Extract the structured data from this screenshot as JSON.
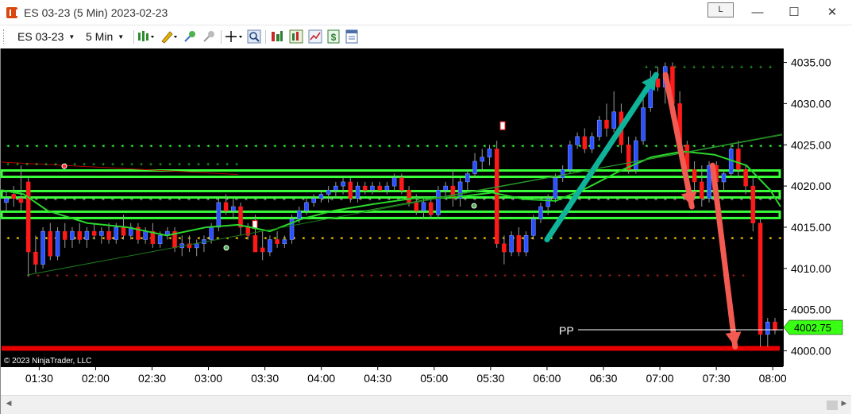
{
  "window": {
    "title": "ES 03-23 (5 Min)  2023-02-23",
    "link_button": "L",
    "minimize_glyph": "—",
    "maximize_glyph": "☐",
    "close_glyph": "✕"
  },
  "toolbar": {
    "instrument": "ES 03-23",
    "interval": "5 Min"
  },
  "chart": {
    "copyright": "© 2023 NinjaTrader, LLC",
    "pp_label": "PP",
    "last_price_badge": "4002.75",
    "colors": {
      "up": "#2a50ff",
      "down": "#ff1a1a",
      "wick": "#9a9a9a",
      "band": "#39ff39",
      "ma": "#2bd82b",
      "arrow_up": "#0fb39a",
      "arrow_down": "#f25a52",
      "support": "#e80000"
    }
  },
  "chart_data": {
    "type": "candlestick",
    "instrument": "ES 03-23",
    "interval": "5 Min",
    "date": "2023-02-23",
    "x_ticks": [
      "01:30",
      "02:00",
      "02:30",
      "03:00",
      "03:30",
      "04:00",
      "04:30",
      "05:00",
      "05:30",
      "06:00",
      "06:30",
      "07:00",
      "07:30",
      "08:00"
    ],
    "y_ticks": [
      "4000.00",
      "4005.00",
      "4010.00",
      "4015.00",
      "4020.00",
      "4025.00",
      "4030.00",
      "4035.00"
    ],
    "ylim": [
      3999.5,
      4036.5
    ],
    "xlim": [
      "01:10",
      "08:05"
    ],
    "levels": {
      "green_bands": [
        4021.5,
        4019.0,
        4016.5
      ],
      "red_support": 4000.3,
      "pp": 4002.5,
      "dots_green_top": 4025.0,
      "dots_green_high": 4034.5,
      "dots_yellow": 4013.8,
      "dots_red_low": 4009.2,
      "dots_white_mid": 4018.5
    },
    "last_price": 4002.75,
    "arrows": [
      {
        "color": "teal",
        "from": [
          "06:00",
          4013.5
        ],
        "to": [
          "06:58",
          4033.5
        ]
      },
      {
        "color": "salmon",
        "from": [
          "07:03",
          4033.5
        ],
        "to": [
          "07:17",
          4017.5
        ]
      },
      {
        "color": "salmon",
        "from": [
          "07:28",
          4022.5
        ],
        "to": [
          "07:40",
          4000.5
        ]
      }
    ],
    "candles": [
      [
        4018,
        4019.5,
        4017,
        4018.5
      ],
      [
        4019,
        4020,
        4017.5,
        4018.5
      ],
      [
        4018.5,
        4022.5,
        4017,
        4018
      ],
      [
        4020.5,
        4021,
        4009,
        4012
      ],
      [
        4012,
        4014,
        4009.5,
        4010.5
      ],
      [
        4010.5,
        4015,
        4010,
        4014.5
      ],
      [
        4014.5,
        4015.5,
        4011,
        4011.5
      ],
      [
        4011.5,
        4015,
        4011,
        4014.5
      ],
      [
        4014.5,
        4015.5,
        4012.5,
        4013.5
      ],
      [
        4013.5,
        4015,
        4012.5,
        4014.5
      ],
      [
        4014.5,
        4015.5,
        4013,
        4013.5
      ],
      [
        4013.5,
        4015,
        4012.5,
        4014.5
      ],
      [
        4014.5,
        4015.5,
        4013.5,
        4014
      ],
      [
        4014,
        4015,
        4013,
        4014.5
      ],
      [
        4014.5,
        4015.5,
        4013,
        4013.5
      ],
      [
        4013.5,
        4015.5,
        4013,
        4015
      ],
      [
        4015,
        4016.5,
        4013.5,
        4014
      ],
      [
        4014,
        4015.5,
        4013.5,
        4015
      ],
      [
        4015,
        4015.5,
        4013,
        4013.5
      ],
      [
        4013.5,
        4015,
        4013,
        4014.5
      ],
      [
        4014.5,
        4015.5,
        4012.5,
        4013
      ],
      [
        4013,
        4014.5,
        4012.5,
        4014
      ],
      [
        4014,
        4015,
        4013.5,
        4014.5
      ],
      [
        4014.5,
        4015,
        4012,
        4012.5
      ],
      [
        4012.5,
        4014,
        4011.5,
        4013
      ],
      [
        4013,
        4014,
        4012,
        4012.5
      ],
      [
        4012.5,
        4013.5,
        4011.5,
        4013
      ],
      [
        4013,
        4014,
        4012,
        4013.5
      ],
      [
        4013.5,
        4015.5,
        4013,
        4015
      ],
      [
        4015,
        4018.5,
        4014.5,
        4018
      ],
      [
        4018,
        4019,
        4016.5,
        4017
      ],
      [
        4017,
        4018.5,
        4016,
        4017.5
      ],
      [
        4017.5,
        4018,
        4014,
        4015
      ],
      [
        4015,
        4015.5,
        4013.5,
        4014
      ],
      [
        4014,
        4016.5,
        4013,
        4012
      ],
      [
        4012.5,
        4014.5,
        4011,
        4012
      ],
      [
        4012,
        4014,
        4011.5,
        4013.5
      ],
      [
        4013.5,
        4014.5,
        4012.5,
        4013
      ],
      [
        4013,
        4014,
        4012.5,
        4013.5
      ],
      [
        4013.5,
        4016.5,
        4013,
        4016
      ],
      [
        4016,
        4017.5,
        4015.5,
        4017
      ],
      [
        4017,
        4018.5,
        4016.5,
        4018
      ],
      [
        4018,
        4019,
        4017.5,
        4018.5
      ],
      [
        4018.5,
        4019.5,
        4018,
        4019
      ],
      [
        4019,
        4020,
        4018,
        4019.5
      ],
      [
        4019.5,
        4020.5,
        4018.5,
        4020
      ],
      [
        4020,
        4021,
        4019,
        4020.5
      ],
      [
        4020.5,
        4021,
        4018,
        4018.5
      ],
      [
        4018.5,
        4020.5,
        4018,
        4020
      ],
      [
        4020,
        4020.5,
        4019,
        4019.5
      ],
      [
        4019.5,
        4020.5,
        4019,
        4020
      ],
      [
        4020,
        4020.5,
        4019.5,
        4019.5
      ],
      [
        4019.5,
        4020.5,
        4019,
        4020
      ],
      [
        4020,
        4021.5,
        4019.5,
        4021
      ],
      [
        4021,
        4021.5,
        4019,
        4019.5
      ],
      [
        4019.5,
        4020,
        4017.5,
        4018
      ],
      [
        4018,
        4019,
        4016.5,
        4017
      ],
      [
        4017,
        4018.5,
        4016,
        4018
      ],
      [
        4018,
        4018.5,
        4016,
        4016.5
      ],
      [
        4016.5,
        4020,
        4016,
        4019.5
      ],
      [
        4019.5,
        4020.5,
        4018.5,
        4020
      ],
      [
        4020,
        4022,
        4017.5,
        4018.5
      ],
      [
        4018.5,
        4021,
        4017.5,
        4020.5
      ],
      [
        4020.5,
        4022,
        4019.5,
        4021.5
      ],
      [
        4021.5,
        4024,
        4021,
        4023
      ],
      [
        4023,
        4024.5,
        4022,
        4023.5
      ],
      [
        4023.5,
        4025,
        4022.5,
        4024.5
      ],
      [
        4024.5,
        4025.5,
        4012.5,
        4013
      ],
      [
        4013,
        4014,
        4010.5,
        4012
      ],
      [
        4012,
        4014.5,
        4011.5,
        4014
      ],
      [
        4014,
        4015,
        4011.5,
        4012
      ],
      [
        4012,
        4014.5,
        4011.5,
        4014
      ],
      [
        4014,
        4016.5,
        4013.5,
        4016
      ],
      [
        4016,
        4018,
        4015.5,
        4017.5
      ],
      [
        4017.5,
        4019,
        4016.5,
        4018.5
      ],
      [
        4018.5,
        4021.5,
        4018,
        4021
      ],
      [
        4021,
        4022.5,
        4020.5,
        4022
      ],
      [
        4022,
        4025.5,
        4021.5,
        4025
      ],
      [
        4025,
        4026.5,
        4024.5,
        4026
      ],
      [
        4026,
        4027,
        4024,
        4024.5
      ],
      [
        4024.5,
        4026.5,
        4024,
        4026
      ],
      [
        4026,
        4028.5,
        4025.5,
        4028
      ],
      [
        4028,
        4030,
        4026,
        4027
      ],
      [
        4027,
        4031.5,
        4026.5,
        4029
      ],
      [
        4029,
        4030,
        4024,
        4025
      ],
      [
        4025,
        4026,
        4021.5,
        4022
      ],
      [
        4022,
        4026,
        4021.5,
        4025.5
      ],
      [
        4025.5,
        4030.5,
        4025,
        4029.5
      ],
      [
        4029.5,
        4034,
        4029,
        4033
      ],
      [
        4033,
        4034.5,
        4031.5,
        4032
      ],
      [
        4032,
        4035,
        4030,
        4034.5
      ],
      [
        4034.5,
        4035,
        4029,
        4030
      ],
      [
        4030,
        4031.5,
        4024,
        4025
      ],
      [
        4025,
        4025.5,
        4021.5,
        4022
      ],
      [
        4022,
        4023,
        4019.5,
        4020.5
      ],
      [
        4020.5,
        4022.5,
        4017.5,
        4018.5
      ],
      [
        4018.5,
        4023,
        4018,
        4022.5
      ],
      [
        4022.5,
        4023,
        4020,
        4020.5
      ],
      [
        4020.5,
        4022,
        4019.5,
        4021.5
      ],
      [
        4021.5,
        4025,
        4021,
        4024.5
      ],
      [
        4024.5,
        4025.5,
        4021,
        4022
      ],
      [
        4022,
        4022.5,
        4019,
        4020
      ],
      [
        4020,
        4021,
        4014.5,
        4015.5
      ],
      [
        4015.5,
        4016,
        4000.5,
        4002
      ],
      [
        4002,
        4004,
        4000.5,
        4003.5
      ],
      [
        4003.5,
        4004,
        4002,
        4002.5
      ]
    ]
  }
}
